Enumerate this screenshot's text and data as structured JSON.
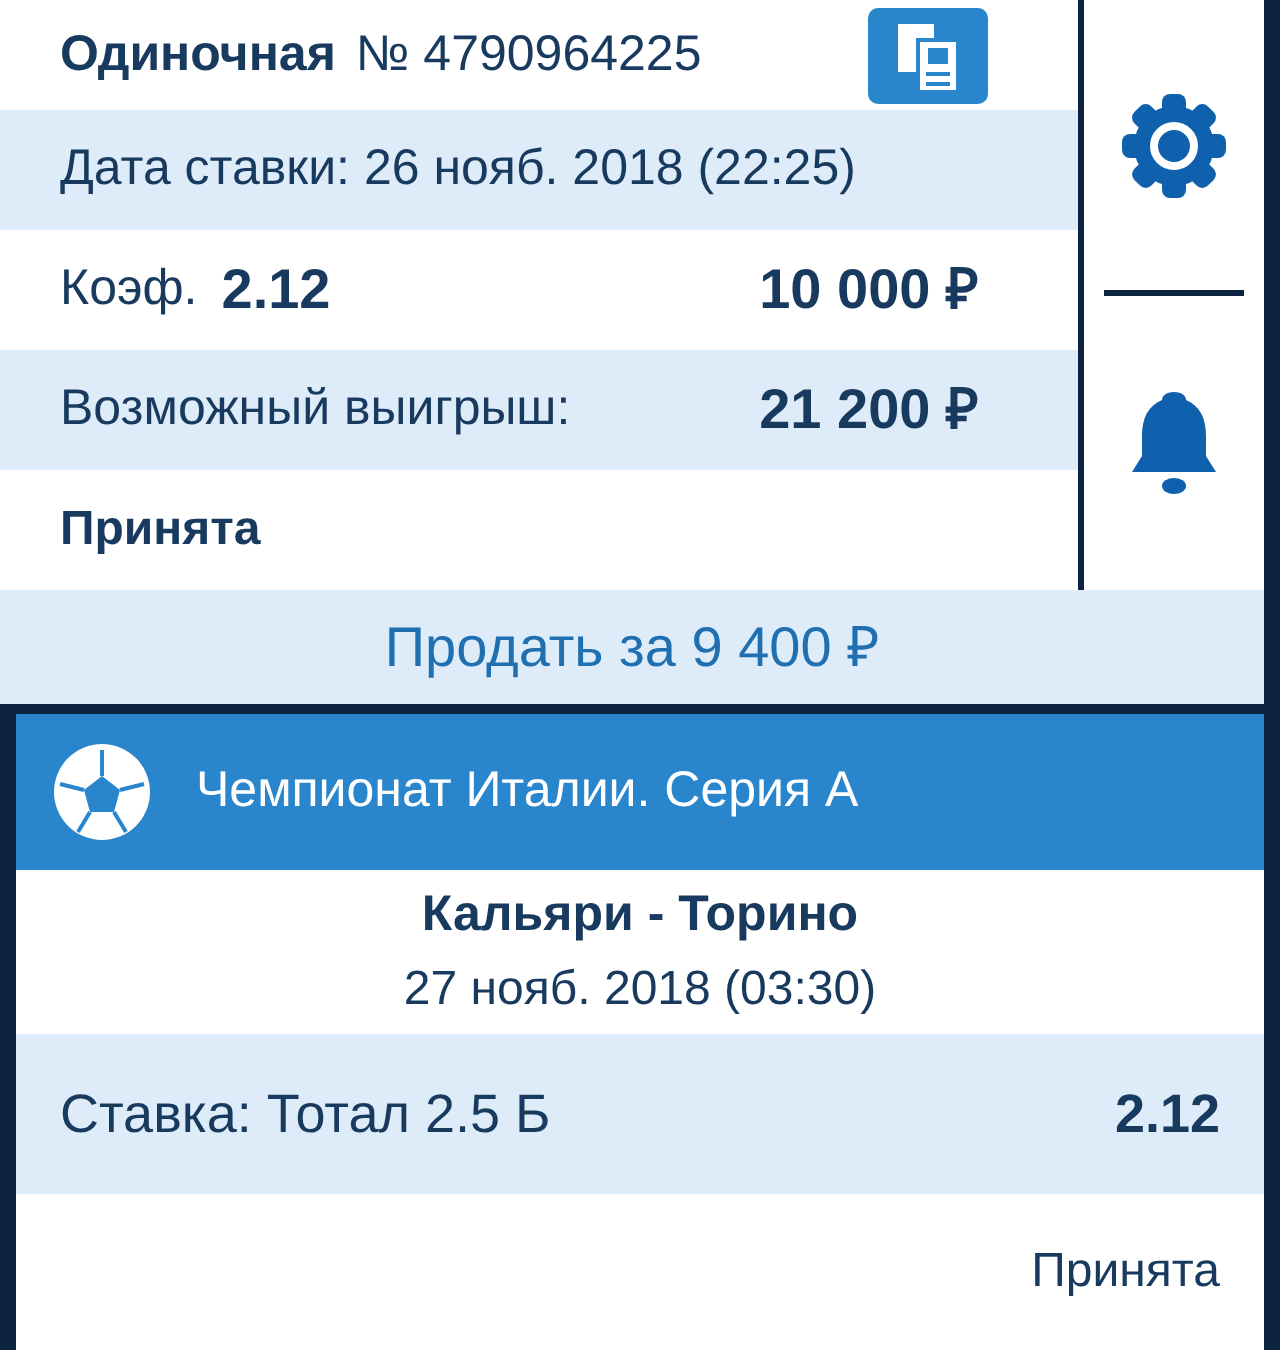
{
  "bet": {
    "type": "Одиночная",
    "number": "№ 4790964225",
    "date": "Дата ставки: 26 нояб. 2018 (22:25)",
    "coef_label": "Коэф.",
    "coef": "2.12",
    "amount": "10 000 ₽",
    "win_label": "Возможный выигрыш:",
    "win": "21 200 ₽",
    "status": "Принята"
  },
  "sell_button": "Продать за 9 400 ₽",
  "event": {
    "league": "Чемпионат Италии. Серия А",
    "match": "Кальяри - Торино",
    "date": "27 нояб. 2018 (03:30)",
    "stake": "Ставка: Тотал 2.5 Б",
    "stake_coef": "2.12",
    "status": "Принята"
  }
}
